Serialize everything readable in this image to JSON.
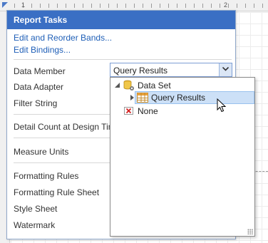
{
  "ruler": {
    "marks": [
      "1",
      "2"
    ]
  },
  "panel": {
    "title": "Report Tasks",
    "links": [
      "Edit and Reorder Bands...",
      "Edit Bindings..."
    ],
    "properties": {
      "data_member": "Data Member",
      "data_adapter": "Data Adapter",
      "filter_string": "Filter String",
      "detail_count": "Detail Count at Design Time",
      "measure_units": "Measure Units",
      "formatting_rules": "Formatting Rules",
      "formatting_rule_sheet": "Formatting Rule Sheet",
      "style_sheet": "Style Sheet",
      "watermark": "Watermark"
    },
    "data_member_value": "Query Results"
  },
  "dropdown": {
    "root": {
      "label": "Data Set",
      "icon": "database-gear-icon",
      "expanded": true
    },
    "child": {
      "label": "Query Results",
      "icon": "table-icon",
      "selected": true
    },
    "none": {
      "label": "None",
      "icon": "red-x-icon"
    }
  },
  "colors": {
    "header": "#3a6fc4",
    "link": "#1f5fb7",
    "selection": "#cce0f7"
  }
}
